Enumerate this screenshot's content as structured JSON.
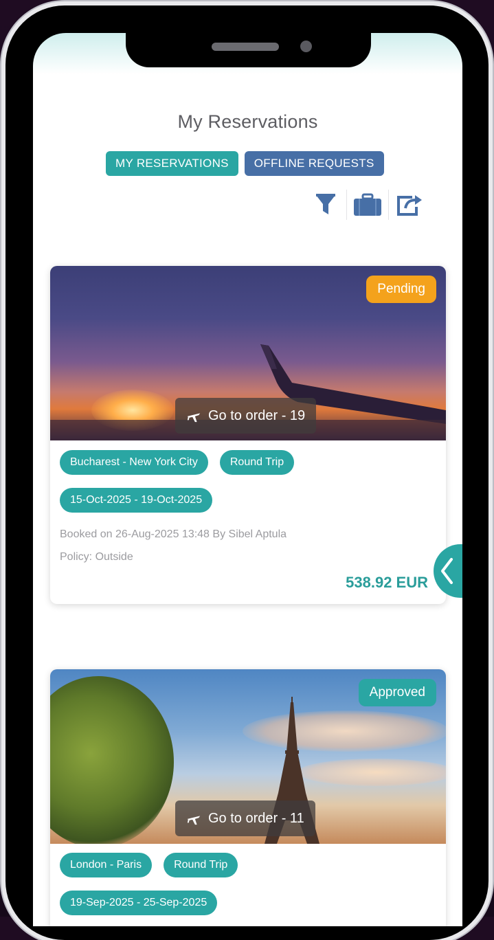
{
  "header": {
    "title": "My Reservations"
  },
  "tabs": [
    {
      "label": "MY RESERVATIONS",
      "active": true
    },
    {
      "label": "OFFLINE REQUESTS",
      "active": false
    }
  ],
  "toolbar": {
    "icons": [
      "filter-icon",
      "briefcase-icon",
      "share-icon"
    ]
  },
  "colors": {
    "teal": "#2aa6a3",
    "blue": "#476fa6",
    "pending": "#f4a21c",
    "price": "#2a9d9a"
  },
  "reservations": [
    {
      "status": "Pending",
      "goto": "Go to order - 19",
      "route": "Bucharest - New York City",
      "trip_type": "Round Trip",
      "dates": "15-Oct-2025 - 19-Oct-2025",
      "booked": "Booked on 26-Aug-2025 13:48 By Sibel Aptula",
      "policy": "Policy: Outside",
      "price": "538.92 EUR"
    },
    {
      "status": "Approved",
      "goto": "Go to order - 11",
      "route": "London - Paris",
      "trip_type": "Round Trip",
      "dates": "19-Sep-2025 - 25-Sep-2025"
    }
  ]
}
